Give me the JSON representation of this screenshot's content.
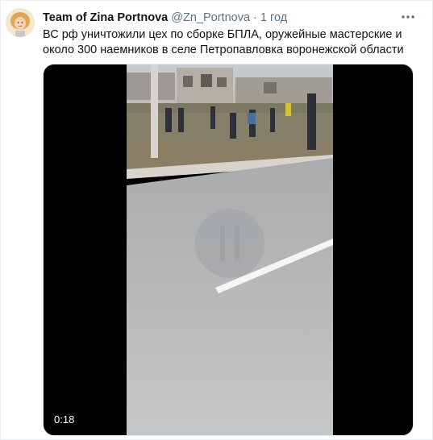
{
  "tweet": {
    "author_name": "Team of Zina Portnova",
    "handle": "@Zn_Portnova",
    "separator": "·",
    "time": "1 год",
    "text": "ВС рф уничтожили цех по сборке БПЛА, оружейные мастерские и около 300 наемников в селе Петропавловка воронежской области"
  },
  "video": {
    "duration": "0:18"
  }
}
